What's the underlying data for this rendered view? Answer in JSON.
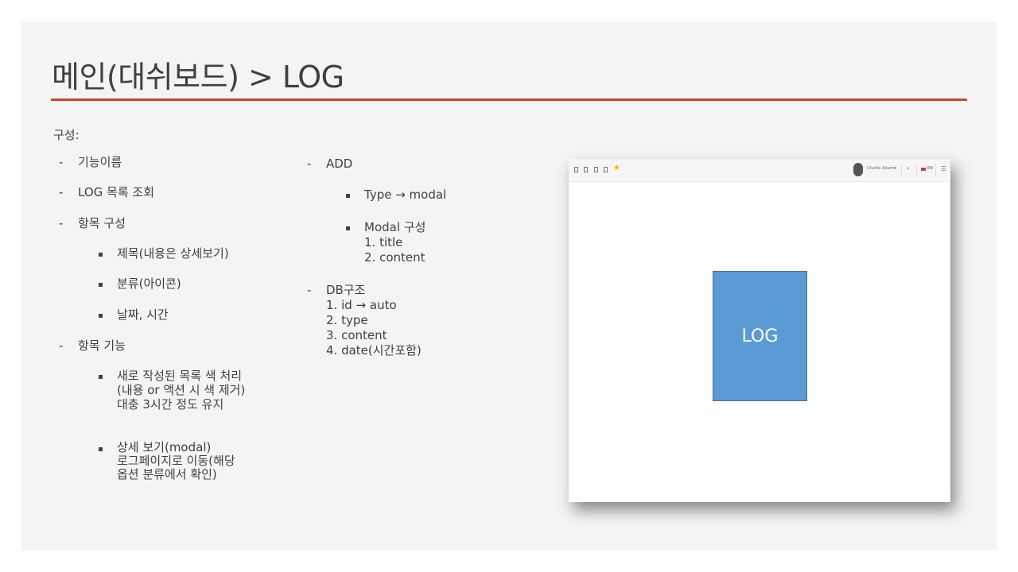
{
  "slide": {
    "title": "메인(대쉬보드) > LOG"
  },
  "left": {
    "heading": "구성:",
    "items": [
      {
        "marker": "-",
        "text": "기능이름"
      },
      {
        "marker": "-",
        "text": "LOG 목록 조회"
      },
      {
        "marker": "-",
        "text": "항목 구성"
      },
      {
        "marker": "▪",
        "text": "제목(내용은 상세보기)"
      },
      {
        "marker": "▪",
        "text": "분류(아이콘)"
      },
      {
        "marker": "▪",
        "text": "날짜, 시간"
      },
      {
        "marker": "-",
        "text": "항목 기능"
      },
      {
        "marker": "▪",
        "text": "새로 작성된 목록 색 처리\n(내용 or 액션 시 색 제거)\n대충 3시간 정도 유지"
      },
      {
        "marker": "▪",
        "text": "상세 보기(modal)\n로그페이지로 이동(해당\n옵션 분류에서 확인)"
      }
    ]
  },
  "middle": {
    "items": [
      {
        "marker": "-",
        "text": "ADD"
      },
      {
        "marker": "▪",
        "text": "Type → modal"
      },
      {
        "marker": "▪",
        "text": "Modal 구성\n1. title\n2. content"
      },
      {
        "marker": "-",
        "text": "DB구조\n1. id → auto\n2. type\n3. content\n4. date(시간포함)"
      }
    ]
  },
  "mock": {
    "user_name": "Charlie Adams",
    "language": "EN",
    "box_label": "LOG",
    "accent_color": "#5b9bd5",
    "rule_color": "#c9482c",
    "icons": [
      "page-icon",
      "mail-icon",
      "clipboard-icon",
      "checklist-icon",
      "star-icon",
      "avatar",
      "chevron-down-icon",
      "search-icon",
      "flag-icon",
      "menu-icon"
    ]
  }
}
